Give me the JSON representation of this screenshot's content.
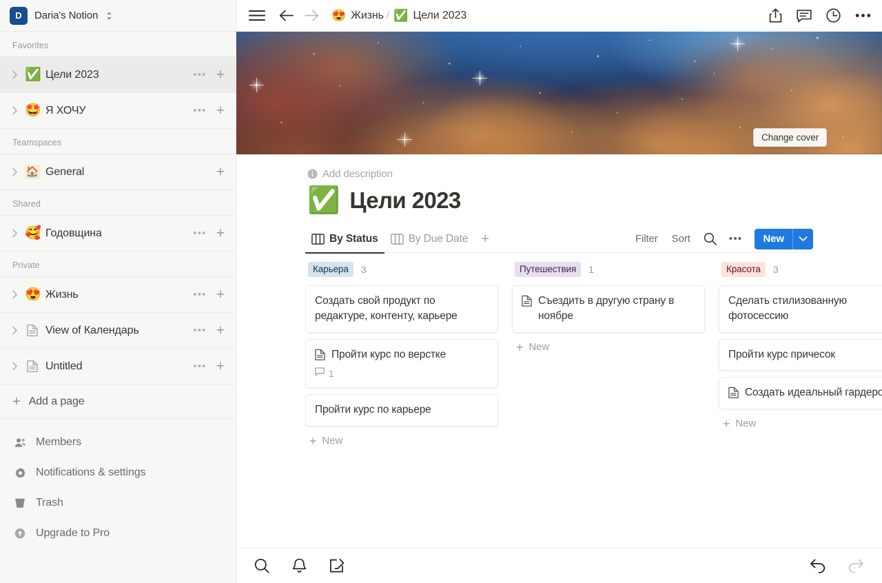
{
  "workspace": {
    "avatar_letter": "D",
    "name": "Daria's Notion",
    "avatar_color": "#1a4d8f"
  },
  "sidebar": {
    "sections": [
      {
        "label": "Favorites",
        "items": [
          {
            "emoji": "✅",
            "label": "Цели 2023",
            "icon": "check-emoji",
            "active": true,
            "has_dots": true,
            "has_plus": true
          },
          {
            "emoji": "🤩",
            "label": "Я ХОЧУ",
            "icon": "star-struck-emoji",
            "active": false,
            "has_dots": true,
            "has_plus": true
          }
        ]
      },
      {
        "label": "Teamspaces",
        "items": [
          {
            "emoji": "🏠",
            "label": "General",
            "icon": "house-emoji",
            "active": false,
            "has_dots": false,
            "has_plus": true
          }
        ]
      },
      {
        "label": "Shared",
        "items": [
          {
            "emoji": "🥰",
            "label": "Годовщина",
            "icon": "smiling-hearts-emoji",
            "active": false,
            "has_dots": true,
            "has_plus": true
          }
        ]
      },
      {
        "label": "Private",
        "items": [
          {
            "emoji": "😍",
            "label": "Жизнь",
            "icon": "heart-eyes-emoji",
            "active": false,
            "has_dots": true,
            "has_plus": true
          },
          {
            "emoji": "",
            "label": "View of Календарь",
            "icon": "page-icon",
            "active": false,
            "has_dots": true,
            "has_plus": true
          },
          {
            "emoji": "",
            "label": "Untitled",
            "icon": "page-icon",
            "active": false,
            "has_dots": true,
            "has_plus": true
          }
        ]
      }
    ],
    "add_page_label": "Add a page",
    "bottom_items": [
      {
        "label": "Members",
        "icon": "members-icon"
      },
      {
        "label": "Notifications & settings",
        "icon": "gear-icon"
      },
      {
        "label": "Trash",
        "icon": "trash-icon"
      },
      {
        "label": "Upgrade to Pro",
        "icon": "upgrade-icon"
      }
    ]
  },
  "topbar": {
    "breadcrumb": [
      {
        "emoji": "😍",
        "label": "Жизнь"
      },
      {
        "emoji": "✅",
        "label": "Цели 2023"
      }
    ],
    "separator": "/",
    "actions": [
      "share-icon",
      "comment-icon",
      "history-icon",
      "more-icon"
    ]
  },
  "cover": {
    "change_cover_label": "Change cover"
  },
  "page": {
    "add_description_label": "Add description",
    "title_emoji": "✅",
    "title": "Цели 2023"
  },
  "view_bar": {
    "tabs": [
      {
        "label": "By Status",
        "active": true
      },
      {
        "label": "By Due Date",
        "active": false
      }
    ],
    "add_view_label": "+",
    "filter_label": "Filter",
    "sort_label": "Sort",
    "search_icon": "search-icon",
    "more_icon": "more-icon",
    "new_label": "New",
    "new_accent": "#1f7ae0"
  },
  "board": {
    "columns": [
      {
        "tag": "Карьера",
        "tag_bg": "#d3e5ef",
        "tag_color": "#183347",
        "count": "3",
        "new_label": "New",
        "cards": [
          {
            "title": "Создать свой продукт по редактуре, контенту, карьере",
            "has_page_icon": false,
            "comments": null
          },
          {
            "title": "Пройти курс по верстке",
            "has_page_icon": true,
            "comments": "1"
          },
          {
            "title": "Пройти курс по карьере",
            "has_page_icon": false,
            "comments": null
          }
        ]
      },
      {
        "tag": "Путешествия",
        "tag_bg": "#e8deee",
        "tag_color": "#412454",
        "count": "1",
        "new_label": "New",
        "cards": [
          {
            "title": "Съездить в другую страну в ноябре",
            "has_page_icon": true,
            "comments": null
          }
        ]
      },
      {
        "tag": "Красота",
        "tag_bg": "#ffe2dd",
        "tag_color": "#5d1715",
        "count": "3",
        "new_label": "New",
        "cards": [
          {
            "title": "Сделать стилизованную фотосессию",
            "has_page_icon": false,
            "comments": null
          },
          {
            "title": "Пройти курс причесок",
            "has_page_icon": false,
            "comments": null
          },
          {
            "title": "Создать идеальный гардероб",
            "has_page_icon": true,
            "comments": null
          }
        ]
      }
    ]
  },
  "bottombar": {
    "left_icons": [
      "search-icon",
      "bell-icon",
      "compose-icon"
    ],
    "right_icons": [
      "undo-icon",
      "redo-icon"
    ]
  }
}
